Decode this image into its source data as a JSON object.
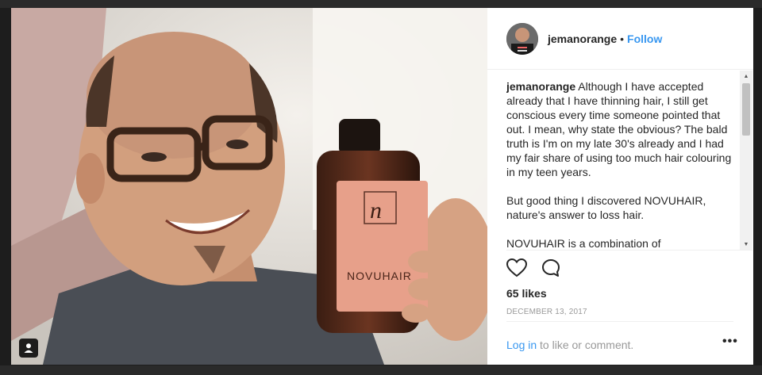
{
  "post": {
    "username": "jemanorange",
    "separator": "•",
    "follow_label": "Follow",
    "caption_paragraphs": [
      "Although I have accepted already that I have thinning hair, I still get conscious every time someone pointed that out. I mean, why state the obvious? The bald truth is I'm on my late 30's already and I had my fair share of using too much hair colouring in my teen years.",
      "But good thing I discovered NOVUHAIR, nature's answer to loss hair.",
      "NOVUHAIR is a combination of"
    ],
    "likes": "65 likes",
    "date": "December 13, 2017",
    "login_link": "Log in",
    "login_suffix": " to like or comment.",
    "more_label": "•••"
  },
  "photo": {
    "bottle_brand": "NOVUHAIR",
    "bottle_logo_letter": "n"
  },
  "icons": {
    "like": "heart-icon",
    "comment": "comment-bubble-icon",
    "user_tag": "person-icon"
  },
  "colors": {
    "link": "#3897f0",
    "text": "#262626",
    "muted": "#999999"
  }
}
